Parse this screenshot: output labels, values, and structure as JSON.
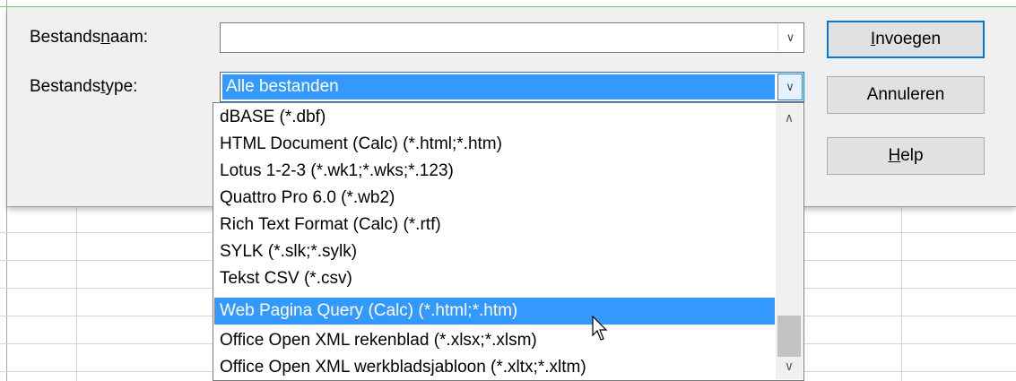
{
  "dialog": {
    "filename_label_pre": "Bestands",
    "filename_label_u": "n",
    "filename_label_post": "aam:",
    "filename_value": "",
    "filetype_label_pre": "Bestands",
    "filetype_label_u": "t",
    "filetype_label_post": "ype:",
    "filetype_value": "Alle bestanden"
  },
  "buttons": {
    "insert_u": "I",
    "insert_rest": "nvoegen",
    "cancel": "Annuleren",
    "help_u": "H",
    "help_rest": "elp"
  },
  "filetype_options": [
    "dBASE (*.dbf)",
    "HTML Document (Calc) (*.html;*.htm)",
    "Lotus 1-2-3 (*.wk1;*.wks;*.123)",
    "Quattro Pro 6.0 (*.wb2)",
    "Rich Text Format (Calc) (*.rtf)",
    "SYLK (*.slk;*.sylk)",
    "Tekst CSV (*.csv)",
    "Web Pagina Query (Calc) (*.html;*.htm)",
    "Office Open XML rekenblad (*.xlsx;*.xlsm)",
    "Office Open XML werkbladsjabloon (*.xltx;*.xltm)"
  ],
  "selected_option_index": 7,
  "colors": {
    "selection": "#3399ff",
    "default_button_border": "#0078d7",
    "dialog_bg": "#f0f0f0"
  }
}
